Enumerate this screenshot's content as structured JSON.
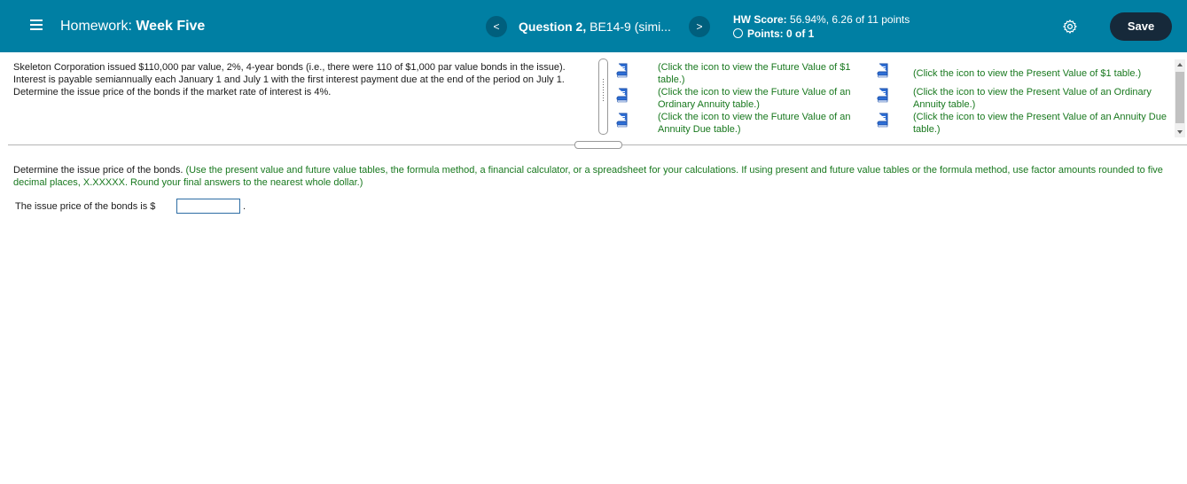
{
  "header": {
    "homework_prefix": "Homework:",
    "homework_name": "Week Five",
    "question_bold": "Question 2,",
    "question_rest": "BE14-9 (simi...",
    "prev_glyph": "<",
    "next_glyph": ">",
    "hw_score_label": "HW Score:",
    "hw_score_value": "56.94%, 6.26 of 11 points",
    "points_label": "Points:",
    "points_value": "0 of 1",
    "save_label": "Save",
    "colors": {
      "bar": "#007fa3",
      "save_button": "#16293a"
    }
  },
  "problem": {
    "text": "Skeleton Corporation issued $110,000 par value, 2%, 4-year bonds (i.e., there were 110 of $1,000 par value bonds in the issue). Interest is payable semiannually each January 1 and July 1 with the first interest payment due at the end of the period on July 1. Determine the issue price of the bonds if the market rate of interest is 4%."
  },
  "table_links": {
    "fv1": "(Click the icon to view the Future Value of $1 table.)",
    "fv_ordinary": "(Click the icon to view the Future Value of an Ordinary Annuity table.)",
    "fv_due": "(Click the icon to view the Future Value of an Annuity Due table.)",
    "pv1": "(Click the icon to view the Present Value of $1 table.)",
    "pv_ordinary": "(Click the icon to view the Present Value of an Ordinary Annuity table.)",
    "pv_due": "(Click the icon to view the Present Value of an Annuity Due table.)"
  },
  "instructions": {
    "main": "Determine the issue price of the bonds.",
    "note": "(Use the present value and future value tables, the formula method, a financial calculator, or a spreadsheet for your calculations. If using present and future value tables or the formula method, use factor amounts rounded to five decimal places, X.XXXXX. Round your final answers to the nearest whole dollar.)"
  },
  "answer": {
    "label": "The issue price of the bonds is $",
    "value": "",
    "suffix": "."
  },
  "icons": [
    "menu-icon",
    "chevron-left-icon",
    "chevron-right-icon",
    "radio-circle-icon",
    "gear-icon",
    "book-icon"
  ]
}
